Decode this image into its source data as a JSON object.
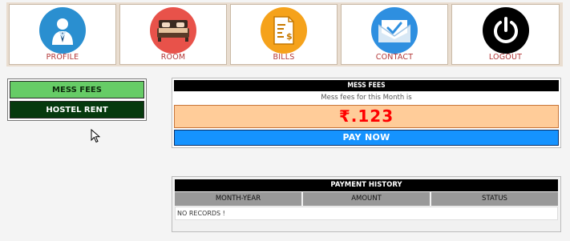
{
  "nav": {
    "items": [
      {
        "label": "PROFILE",
        "icon": "profile-icon",
        "color": "#2a8fd0"
      },
      {
        "label": "ROOM",
        "icon": "bed-icon",
        "color": "#e8524a"
      },
      {
        "label": "BILLS",
        "icon": "bill-icon",
        "color": "#f5a21b"
      },
      {
        "label": "CONTACT",
        "icon": "mail-icon",
        "color": "#2e8fe0"
      },
      {
        "label": "LOGOUT",
        "icon": "power-icon",
        "color": "#000000"
      }
    ],
    "label_color": "#b33838"
  },
  "side_menu": {
    "mess_fees": "MESS FEES",
    "hostel_rent": "HOSTEL RENT"
  },
  "fees": {
    "title": "MESS FEES",
    "subtitle": "Mess fees for this Month is",
    "amount": "₹.123",
    "pay_button": "PAY NOW"
  },
  "history": {
    "title": "PAYMENT HISTORY",
    "columns": [
      "MONTH-YEAR",
      "AMOUNT",
      "STATUS"
    ],
    "empty_text": "NO RECORDS !"
  }
}
